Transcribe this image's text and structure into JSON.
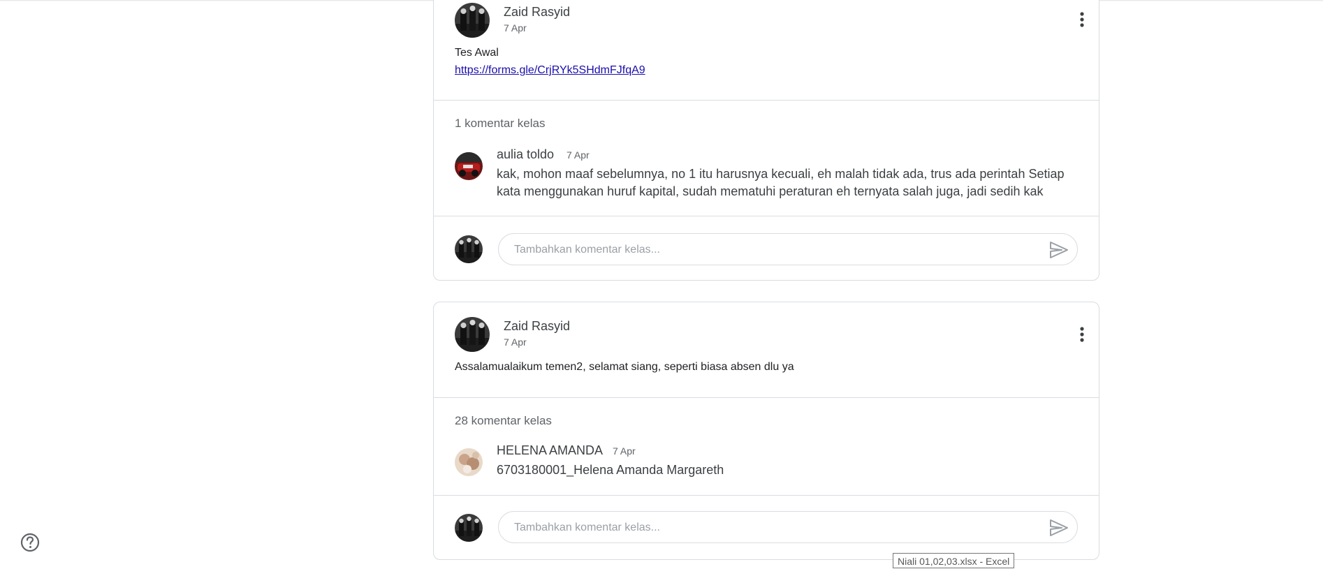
{
  "posts": [
    {
      "author": "Zaid Rasyid",
      "date": "7 Apr",
      "text": "Tes Awal",
      "link": "https://forms.gle/CrjRYk5SHdmFJfqA9",
      "comment_count_label": "1 komentar kelas",
      "comments": [
        {
          "name": "aulia toldo",
          "date": "7 Apr",
          "line1": "kak, mohon maaf sebelumnya, no 1 itu harusnya kecuali, eh malah tidak ada, trus ada perintah Setiap",
          "line2": "kata menggunakan huruf kapital, sudah mematuhi peraturan eh ternyata salah juga, jadi sedih kak"
        }
      ],
      "comment_placeholder": "Tambahkan komentar kelas..."
    },
    {
      "author": "Zaid Rasyid",
      "date": "7 Apr",
      "text": "Assalamualaikum temen2, selamat siang, seperti biasa absen dlu ya",
      "comment_count_label": "28 komentar kelas",
      "comments": [
        {
          "name": "HELENA AMANDA",
          "date": "7 Apr",
          "line1": "6703180001_Helena Amanda Margareth"
        }
      ],
      "comment_placeholder": "Tambahkan komentar kelas..."
    }
  ],
  "tooltip": "Niali 01,02,03.xlsx - Excel",
  "icons": {
    "more": "more-vert-icon",
    "send": "send-icon",
    "help": "help-circle-icon"
  },
  "colors": {
    "link": "#1a0dab",
    "border": "#dadce0",
    "secondary_text": "#5f6368"
  }
}
